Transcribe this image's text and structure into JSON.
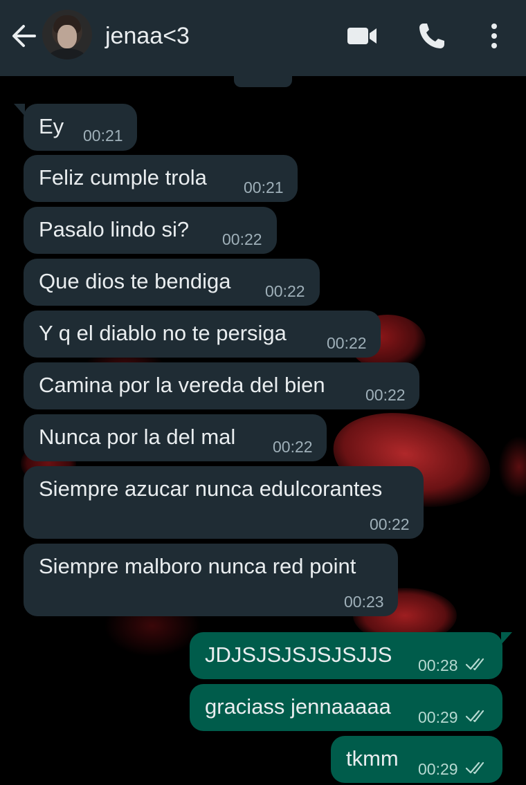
{
  "header": {
    "contact_name": "jenaa<3",
    "icons": {
      "back": "arrow-left-icon",
      "video": "video-camera-icon",
      "call": "phone-icon",
      "menu": "more-vertical-icon"
    }
  },
  "colors": {
    "header_bg": "#1f2c34",
    "incoming_bubble": "#1f2c34",
    "outgoing_bubble": "#005c4b",
    "text": "#e9edef",
    "read_ticks": "#b6d9d1"
  },
  "messages": [
    {
      "direction": "incoming",
      "text": "Ey",
      "time": "00:21"
    },
    {
      "direction": "incoming",
      "text": "Feliz cumple trola",
      "time": "00:21"
    },
    {
      "direction": "incoming",
      "text": "Pasalo lindo si?",
      "time": "00:22"
    },
    {
      "direction": "incoming",
      "text": "Que dios te bendiga",
      "time": "00:22"
    },
    {
      "direction": "incoming",
      "text": "Y q el diablo no te persiga",
      "time": "00:22"
    },
    {
      "direction": "incoming",
      "text": "Camina por la vereda del bien",
      "time": "00:22"
    },
    {
      "direction": "incoming",
      "text": "Nunca por la del mal",
      "time": "00:22"
    },
    {
      "direction": "incoming",
      "text": "Siempre azucar nunca edulcorantes",
      "time": "00:22"
    },
    {
      "direction": "incoming",
      "text": "Siempre malboro nunca red point",
      "time": "00:23"
    },
    {
      "direction": "outgoing",
      "text": "JDJSJSJSJSJSJJS",
      "time": "00:28",
      "status": "delivered"
    },
    {
      "direction": "outgoing",
      "text": "graciass jennaaaaa",
      "time": "00:29",
      "status": "delivered"
    },
    {
      "direction": "outgoing",
      "text": "tkmm",
      "time": "00:29",
      "status": "delivered"
    }
  ]
}
